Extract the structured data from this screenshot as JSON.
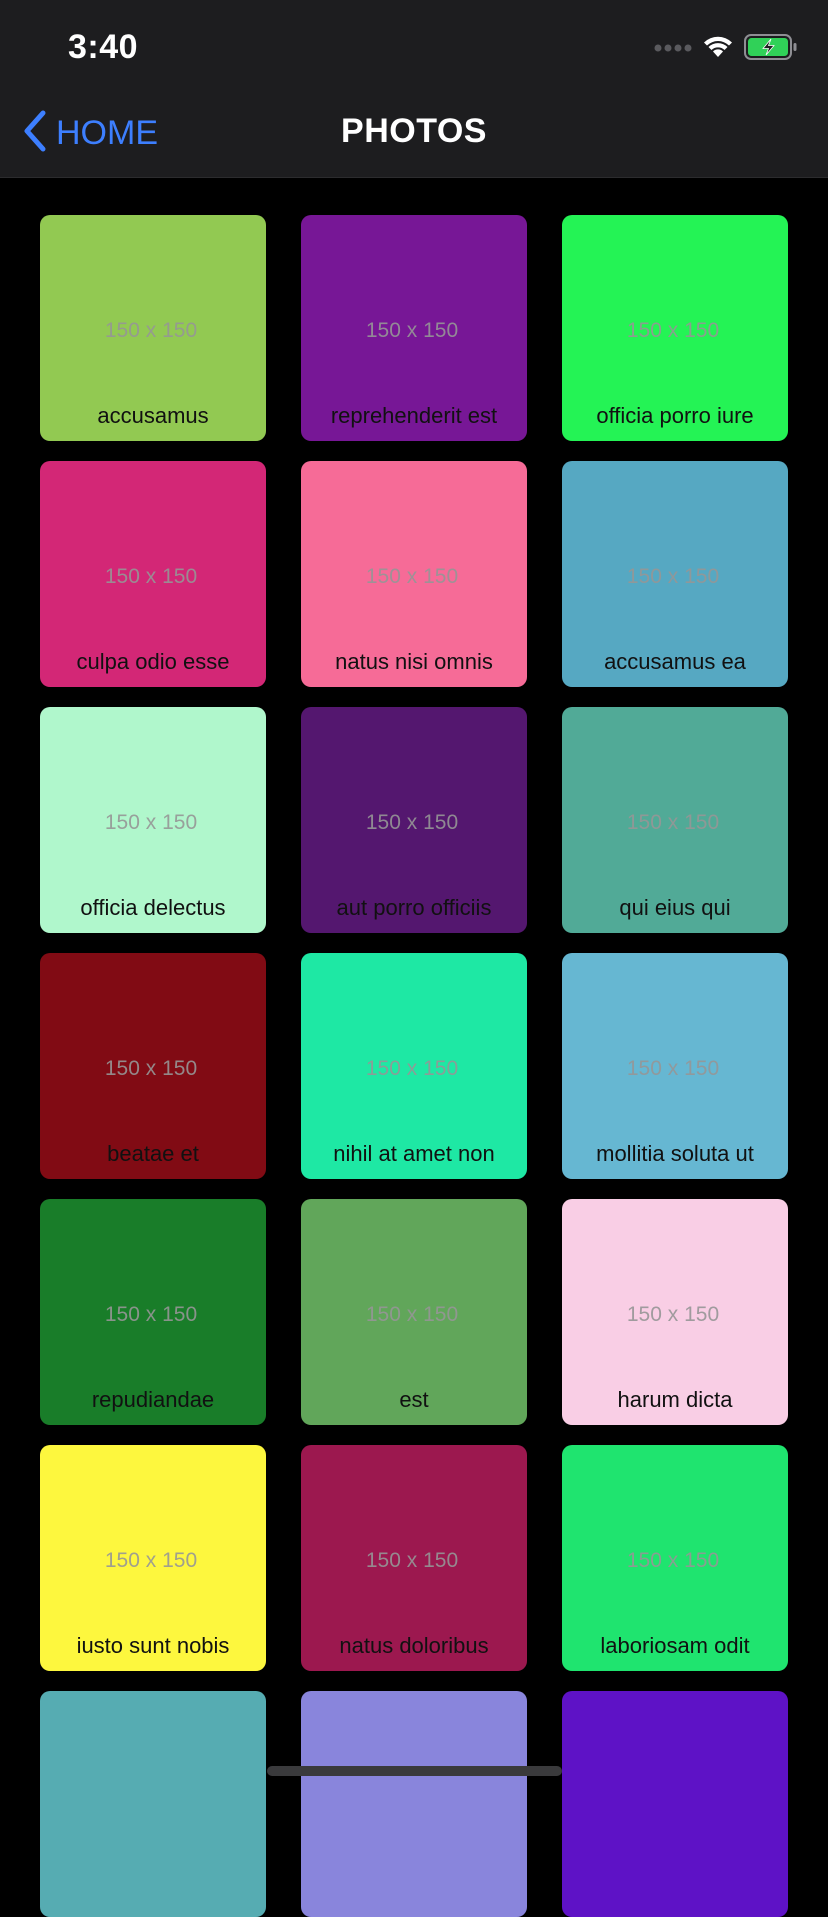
{
  "status_bar": {
    "time": "3:40",
    "signal_icon": "signal-dots-icon",
    "wifi_icon": "wifi-icon",
    "battery_icon": "battery-charging-icon",
    "battery_color": "#30d158"
  },
  "nav": {
    "back_label": "HOME",
    "back_icon": "chevron-left-icon",
    "title": "PHOTOS",
    "accent": "#3d7fff"
  },
  "photos": [
    {
      "title": "accusamus",
      "placeholder": "150 x 150",
      "color": "#92c952"
    },
    {
      "title": "reprehenderit est",
      "placeholder": "150 x 150",
      "color": "#771796"
    },
    {
      "title": "officia porro iure",
      "placeholder": "150 x 150",
      "color": "#24f355"
    },
    {
      "title": "culpa odio esse",
      "placeholder": "150 x 150",
      "color": "#d32776"
    },
    {
      "title": "natus nisi omnis",
      "placeholder": "150 x 150",
      "color": "#f66b97"
    },
    {
      "title": "accusamus ea",
      "placeholder": "150 x 150",
      "color": "#56a8c2"
    },
    {
      "title": "officia delectus",
      "placeholder": "150 x 150",
      "color": "#b0f7cc"
    },
    {
      "title": "aut porro officiis",
      "placeholder": "150 x 150",
      "color": "#54176f"
    },
    {
      "title": "qui eius qui",
      "placeholder": "150 x 150",
      "color": "#51aa97"
    },
    {
      "title": "beatae et",
      "placeholder": "150 x 150",
      "color": "#810b14"
    },
    {
      "title": "nihil at amet non",
      "placeholder": "150 x 150",
      "color": "#1ee8a4"
    },
    {
      "title": "mollitia soluta ut",
      "placeholder": "150 x 150",
      "color": "#66b7d2"
    },
    {
      "title": "repudiandae",
      "placeholder": "150 x 150",
      "color": "#197d29"
    },
    {
      "title": "est",
      "placeholder": "150 x 150",
      "color": "#61a65a"
    },
    {
      "title": "harum dicta",
      "placeholder": "150 x 150",
      "color": "#f9cee5"
    },
    {
      "title": "iusto sunt nobis",
      "placeholder": "150 x 150",
      "color": "#fdf73e"
    },
    {
      "title": "natus doloribus",
      "placeholder": "150 x 150",
      "color": "#9c184f"
    },
    {
      "title": "laboriosam odit",
      "placeholder": "150 x 150",
      "color": "#1fe46f"
    },
    {
      "title": "",
      "placeholder": "",
      "color": "#56acb2"
    },
    {
      "title": "",
      "placeholder": "",
      "color": "#8985dc"
    },
    {
      "title": "",
      "placeholder": "",
      "color": "#5e12c6"
    }
  ]
}
